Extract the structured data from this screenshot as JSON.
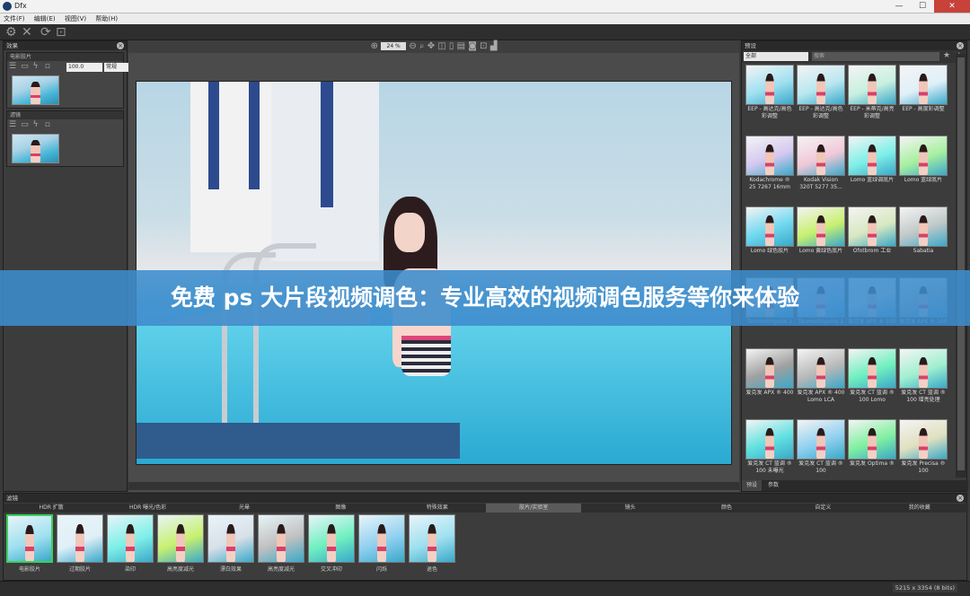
{
  "window": {
    "title": "Dfx",
    "min": "—",
    "max": "☐",
    "close": "✕"
  },
  "menu": [
    "文件(F)",
    "编辑(E)",
    "视图(V)",
    "帮助(H)"
  ],
  "left_panel": {
    "title": "效果",
    "group1": {
      "title": "电影胶片",
      "value": "100.0",
      "mode": "常规"
    },
    "group2": {
      "title": "滤镜"
    }
  },
  "center": {
    "zoom": "24 %"
  },
  "right_panel": {
    "title": "预设",
    "category": "全部",
    "search_placeholder": "搜索",
    "presets": [
      "EEP - 高达克/高色彩调整",
      "EEP - 高达克/高色彩调整",
      "EEP - 米蒂克/高亮彩调整",
      "EEP - 高度彩调整",
      "Kodachrome ® 25 7267 16mm",
      "Kodak Vision 320T 5277 35...",
      "Lomo 蓝绿调底片",
      "Lomo 蓝绿底片",
      "Lomo 绿色胶片",
      "Lomo 黄绿色底片",
      "Ofotbrom 工业",
      "Sabatia",
      "Tenmerlingolot 1",
      "Tenmerlingolot 2",
      "爱克发 APX ® 100",
      "爱克发 APX ® 100",
      "爱克发 APX ® 400",
      "爱克发 APX ® 400 Lomo LCA",
      "爱克发 CT 蓝调 ® 100 Lomo",
      "爱克发 CT 蓝调 ® 100 增亮处理",
      "爱克发 CT 蓝调 ® 100 未曝光",
      "爱克发 CT 蓝调 ® 100",
      "爱克发 Optima ®",
      "爱克发 Precisa ® 100"
    ],
    "tabs": [
      "预设",
      "参数"
    ]
  },
  "bottom_panel": {
    "title": "滤镜",
    "tabs": [
      "HDR 扩散",
      "HDR 曝光/色彩",
      "光晕",
      "图像",
      "特殊效果",
      "胶片/实验室",
      "镜头",
      "颜色",
      "自定义",
      "我的收藏"
    ],
    "active_tab": 5,
    "thumbs": [
      "电影胶片",
      "过期胶片",
      "染印",
      "高亮度减光",
      "漂白效果",
      "高亮度减光",
      "交叉冲印",
      "闪烁",
      "退色"
    ]
  },
  "status": {
    "resolution": "5215 x 3354 (8 bits)"
  },
  "banner": {
    "text": "免费 ps 大片段视频调色：专业高效的视频调色服务等你来体验"
  },
  "colors": {
    "banner_bg": "#3c8ccd",
    "panel_bg": "#3c3c3c",
    "accent_green": "#3bd15a"
  }
}
